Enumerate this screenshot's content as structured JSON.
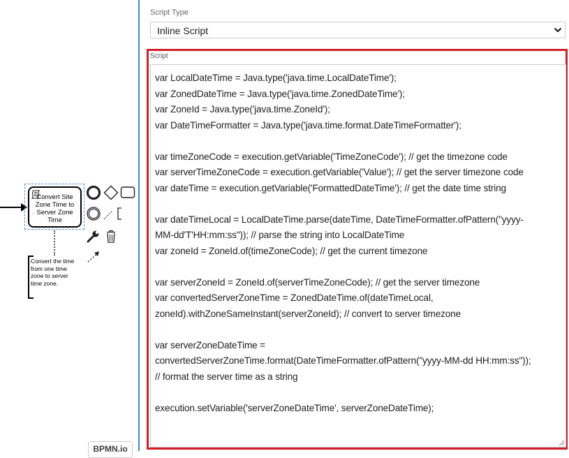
{
  "canvas": {
    "task": {
      "label": "Convert Site\nZone Time to\nServer Zone\nTime",
      "icon": "script-icon"
    },
    "annotation": {
      "text": "Convert the time\nfrom one time\nzone to server\ntime zone."
    },
    "context_pad": {
      "icons": [
        "end-event-icon",
        "gateway-icon",
        "task-icon",
        "intermediate-event-icon",
        "text-annotation-icon",
        "wrench-icon",
        "trash-icon",
        "connect-arrow-icon"
      ]
    },
    "watermark": "BPMN.io"
  },
  "panel": {
    "script_type": {
      "label": "Script Type",
      "value": "Inline Script"
    },
    "script": {
      "label": "Script",
      "value": "var LocalDateTime = Java.type('java.time.LocalDateTime');\nvar ZonedDateTime = Java.type('java.time.ZonedDateTime');\nvar ZoneId = Java.type('java.time.ZoneId');\nvar DateTimeFormatter = Java.type('java.time.format.DateTimeFormatter');\n\nvar timeZoneCode = execution.getVariable('TimeZoneCode'); // get the timezone code\nvar serverTimeZoneCode = execution.getVariable('Value'); // get the server timezone code\nvar dateTime = execution.getVariable('FormattedDateTime'); // get the date time string\n\nvar dateTimeLocal = LocalDateTime.parse(dateTime, DateTimeFormatter.ofPattern(\"yyyy-\nMM-dd'T'HH:mm:ss\")); // parse the string into LocalDateTime\nvar zoneId = ZoneId.of(timeZoneCode); // get the current timezone\n\nvar serverZoneId = ZoneId.of(serverTimeZoneCode); // get the server timezone\nvar convertedServerZoneTime = ZonedDateTime.of(dateTimeLocal,\nzoneId).withZoneSameInstant(serverZoneId); // convert to server timezone\n\nvar serverZoneDateTime =\nconvertedServerZoneTime.format(DateTimeFormatter.ofPattern(\"yyyy-MM-dd HH:mm:ss\"));\n// format the server time as a string\n\nexecution.setVariable('serverZoneDateTime', serverZoneDateTime);"
    },
    "colors": {
      "divider": "#3b86d6",
      "highlight": "#d21f26",
      "selection": "#4a90d9"
    }
  }
}
